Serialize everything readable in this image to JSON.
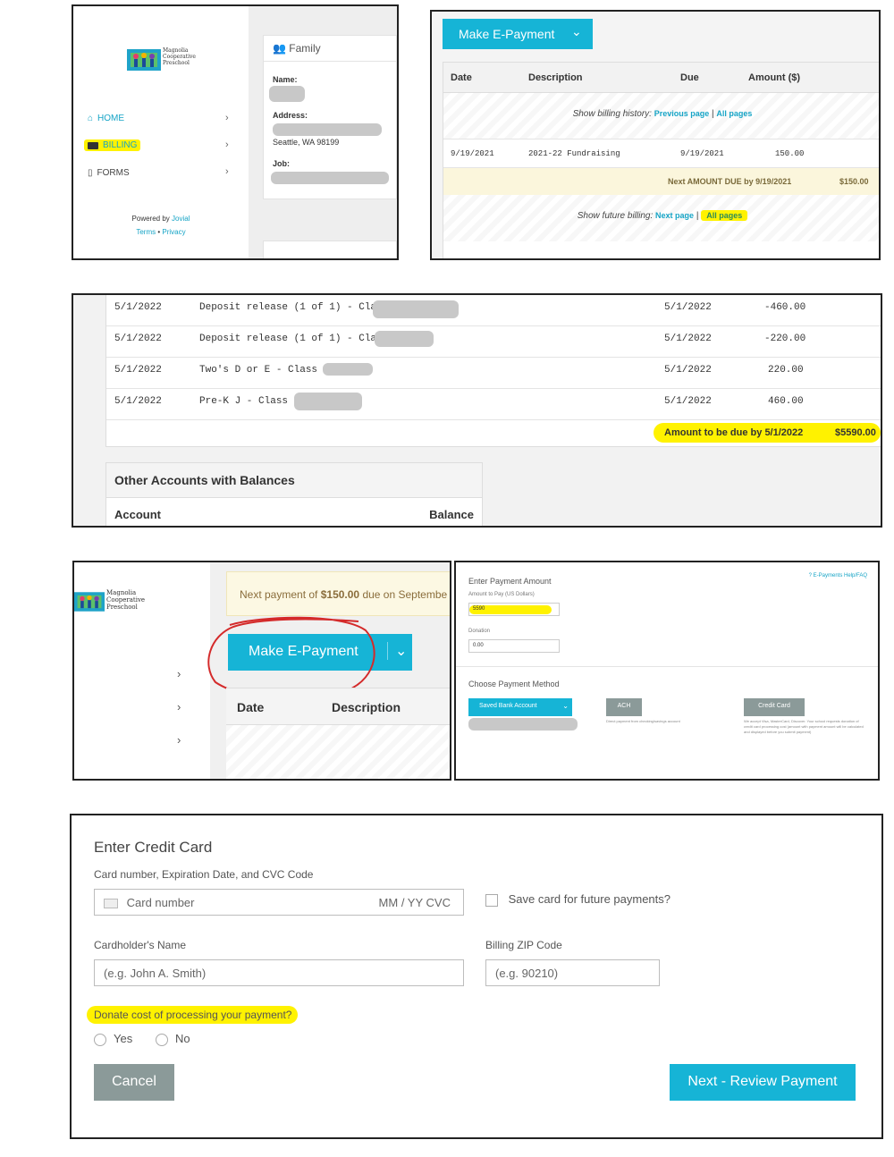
{
  "colors": {
    "accent": "#16b4d6",
    "highlight": "#fff200",
    "due_row": "#fbf6dc",
    "cancel_gray": "#8b9a99"
  },
  "panel1": {
    "logo_text": [
      "Magnolia",
      "Cooperative",
      "Preschool"
    ],
    "nav": [
      {
        "label": "HOME",
        "icon": "home-icon"
      },
      {
        "label": "BILLING",
        "icon": "money-icon"
      },
      {
        "label": "FORMS",
        "icon": "document-icon"
      }
    ],
    "powered_by": "Powered by",
    "powered_brand": "Jovial",
    "terms": "Terms",
    "dot": "•",
    "privacy": "Privacy",
    "family_header": "Family",
    "name_label": "Name:",
    "address_label": "Address:",
    "address_city": "Seattle, WA 98199",
    "job_label": "Job:"
  },
  "panel2": {
    "make_payment": "Make E-Payment",
    "headers": [
      "Date",
      "Description",
      "Due",
      "Amount ($)"
    ],
    "history_text": "Show billing history:",
    "previous_page": "Previous page",
    "separator": "|",
    "all_pages": "All pages",
    "row": {
      "date": "9/19/2021",
      "description": "2021-22 Fundraising",
      "due": "9/19/2021",
      "amount": "150.00"
    },
    "next_due_label": "Next AMOUNT DUE by 9/19/2021",
    "next_due_amount": "$150.00",
    "future_text": "Show future billing:",
    "next_page": "Next page",
    "all_pages_future": "All pages"
  },
  "panel3": {
    "rows": [
      {
        "date": "5/1/2022",
        "description": "Deposit release (1 of 1) - Class",
        "due": "5/1/2022",
        "amount": "-460.00"
      },
      {
        "date": "5/1/2022",
        "description": "Deposit release (1 of 1) - Class",
        "due": "5/1/2022",
        "amount": "-220.00"
      },
      {
        "date": "5/1/2022",
        "description": "Two's D or E - Class E",
        "due": "5/1/2022",
        "amount": "220.00"
      },
      {
        "date": "5/1/2022",
        "description": "Pre-K J - Class J",
        "due": "5/1/2022",
        "amount": "460.00"
      }
    ],
    "total_label": "Amount to be due by 5/1/2022",
    "total_amount": "$5590.00",
    "other_accounts_title": "Other Accounts with Balances",
    "account_header": "Account",
    "balance_header": "Balance"
  },
  "panel4": {
    "next_payment_prefix": "Next payment of",
    "next_payment_amount": "$150.00",
    "next_payment_suffix": "due on Septembe",
    "make_payment": "Make E-Payment",
    "headers": [
      "Date",
      "Description"
    ]
  },
  "panel5": {
    "help_link": "E-Payments Help/FAQ",
    "enter_amount_title": "Enter Payment Amount",
    "amount_label": "Amount to Pay (US Dollars)",
    "amount_value": "5590",
    "donation_label": "Donation",
    "donation_value": "0.00",
    "choose_method": "Choose Payment Method",
    "saved_bank": "Saved Bank Account",
    "ach": "ACH",
    "ach_desc": "Direct payment from checking/savings account",
    "credit_card": "Credit Card",
    "cc_desc": "We accept Visa, MasterCard, Discover. Your school requests donation of credit card processing cost (amount with payment amount will be calculated and displayed before you submit payment)"
  },
  "panel6": {
    "title": "Enter Credit Card",
    "card_label": "Card number, Expiration Date, and CVC Code",
    "card_placeholder": "Card number",
    "card_exp": "MM / YY",
    "card_cvc": "CVC",
    "save_card": "Save card for future payments?",
    "name_label": "Cardholder's Name",
    "name_placeholder": "(e.g. John A. Smith)",
    "zip_label": "Billing ZIP Code",
    "zip_placeholder": "(e.g. 90210)",
    "donate_question": "Donate cost of processing your payment?",
    "yes": "Yes",
    "no": "No",
    "cancel": "Cancel",
    "next": "Next - Review Payment"
  }
}
